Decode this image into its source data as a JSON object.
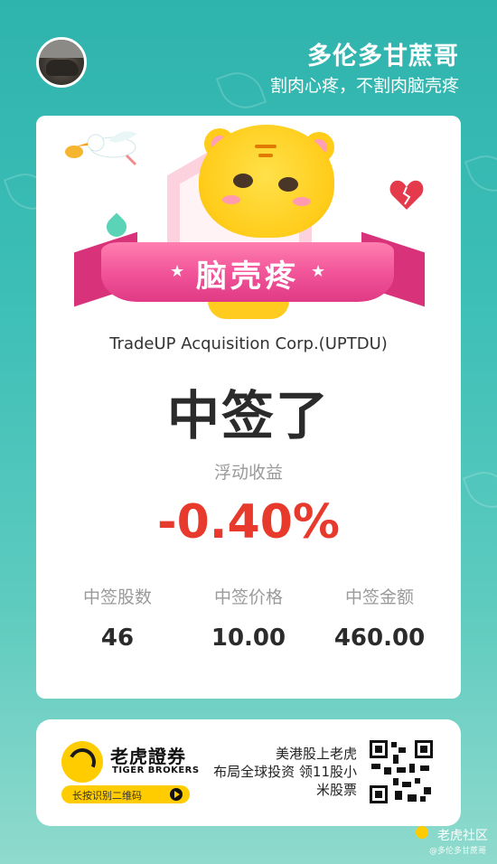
{
  "header": {
    "user_name": "多伦多甘蔗哥",
    "user_slogan": "割肉心疼，不割肉脑壳疼"
  },
  "card": {
    "banner_text": "脑壳疼",
    "company": "TradeUP Acquisition Corp.(UPTDU)",
    "status_title": "中签了",
    "pnl_label": "浮动收益",
    "pnl_value": "-0.40%",
    "stats": [
      {
        "label": "中签股数",
        "value": "46"
      },
      {
        "label": "中签价格",
        "value": "10.00"
      },
      {
        "label": "中签金额",
        "value": "460.00"
      }
    ]
  },
  "promo": {
    "broker_name_cn": "老虎證券",
    "broker_name_en": "TIGER BROKERS",
    "scan_hint": "长按识别二维码",
    "text_line1": "美港股上老虎",
    "text_line2": "布局全球投资 领11股小",
    "text_line3": "米股票"
  },
  "watermark": {
    "brand": "老虎社区",
    "user": "@多伦多甘蔗哥"
  },
  "colors": {
    "background": "#3dbfb7",
    "pnl_negative": "#e8392d",
    "ribbon": "#f2559a",
    "brand_yellow": "#ffcc00"
  },
  "icons": {
    "avatar": "bull-statue-avatar",
    "banner": "tiger-mascot",
    "logo": "tiger-brokers-logo",
    "qr": "qr-code"
  }
}
